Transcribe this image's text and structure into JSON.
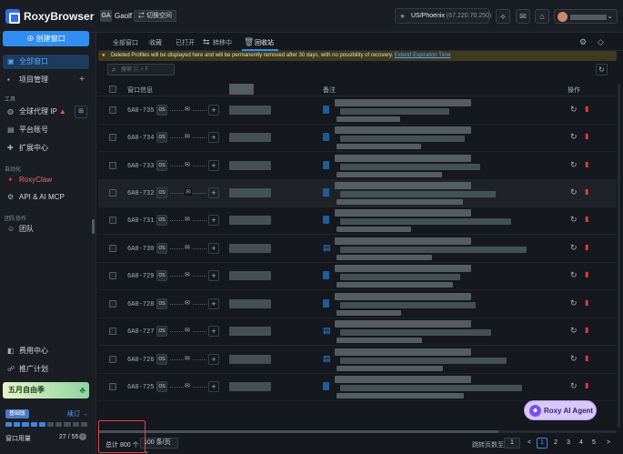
{
  "app": {
    "brand": "RoxyBrowser"
  },
  "topbar": {
    "workspace_badge": "GA",
    "workspace_name": "Gaolf",
    "switch_label": "⇄ 切换空间",
    "location": "US/Phoenix",
    "ip": "(67.220.70.250)"
  },
  "sidebar": {
    "create_label": "⊕ 创建窗口",
    "all_windows": "全部窗口",
    "project_mgmt": "项目管理",
    "section_tools": "工具",
    "global_proxy": "全球代理 IP",
    "platform_accounts": "平台账号",
    "extensions": "扩展中心",
    "section_automation": "自动化",
    "roxyclaw": "RoxyClaw",
    "api_mcp": "API & AI MCP",
    "section_team": "团队协作",
    "team": "团队",
    "billing": "费用中心",
    "referral": "推广计划",
    "promo": "五月自由季",
    "plan_badge": "基础版",
    "renew": "续订 →",
    "usage_label": "窗口用量",
    "usage_value": "27 / 55",
    "usage_fraction": 0.49
  },
  "tabs": [
    {
      "label": "全部窗口"
    },
    {
      "label": "收藏"
    },
    {
      "label": "已打开"
    },
    {
      "label": "转移中"
    },
    {
      "label": "回收站"
    }
  ],
  "banner": {
    "text": "Deleted Profiles will be displayed here and will be permanently removed after 30 days, with no possibility of recovery.",
    "link": "Extend Expiration Time"
  },
  "search": {
    "placeholder": "搜索 ⌘ + F"
  },
  "table": {
    "headers": {
      "window": "窗口信息",
      "note": "备注",
      "actions": "操作"
    },
    "rows": [
      {
        "id": "6A0-735"
      },
      {
        "id": "6A0-734"
      },
      {
        "id": "6A0-733"
      },
      {
        "id": "6A0-732"
      },
      {
        "id": "6A0-731"
      },
      {
        "id": "6A0-730"
      },
      {
        "id": "6A0-729"
      },
      {
        "id": "6A0-728"
      },
      {
        "id": "6A0-727"
      },
      {
        "id": "6A0-726"
      },
      {
        "id": "6A0-725"
      }
    ]
  },
  "footer": {
    "total": "总计 800 个",
    "page_size": "100 条/页 ⌄",
    "jump_label": "跳转页数至",
    "jump_value": "1",
    "pages": [
      "<",
      "1",
      "2",
      "3",
      "4",
      "5",
      ">"
    ]
  },
  "ai": {
    "label": "Roxy AI Agent"
  },
  "colors": {
    "accent": "#2f8ef0",
    "danger": "#e23b3b",
    "background": "#15181e"
  }
}
